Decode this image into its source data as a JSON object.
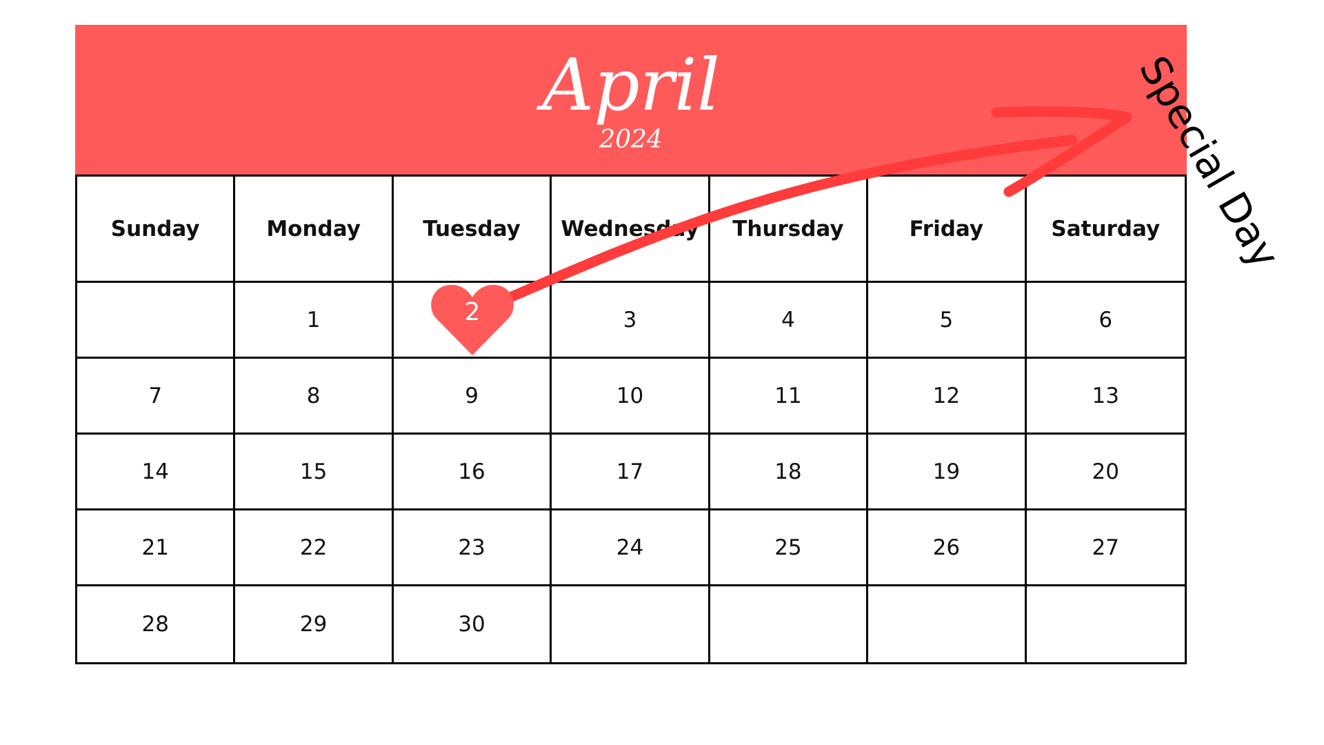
{
  "calendar": {
    "month": "April",
    "year": "2024",
    "weekdays": [
      "Sunday",
      "Monday",
      "Tuesday",
      "Wednesday",
      "Thursday",
      "Friday",
      "Saturday"
    ],
    "weeks": [
      [
        "",
        "1",
        "2",
        "3",
        "4",
        "5",
        "6"
      ],
      [
        "7",
        "8",
        "9",
        "10",
        "11",
        "12",
        "13"
      ],
      [
        "14",
        "15",
        "16",
        "17",
        "18",
        "19",
        "20"
      ],
      [
        "21",
        "22",
        "23",
        "24",
        "25",
        "26",
        "27"
      ],
      [
        "28",
        "29",
        "30",
        "",
        "",
        "",
        ""
      ]
    ],
    "highlighted_day": "2"
  },
  "annotation": {
    "label": "Special Day",
    "icon": "heart-icon",
    "arrow_icon": "arrow-icon"
  },
  "colors": {
    "accent": "#ff5a5a",
    "arrow": "#ff3b3b",
    "grid_line": "#000000",
    "text": "#111111"
  }
}
